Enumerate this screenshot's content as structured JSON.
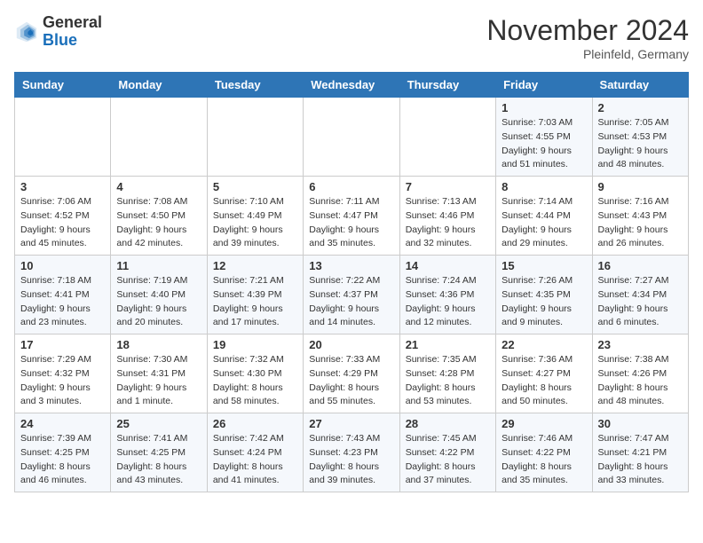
{
  "logo": {
    "general": "General",
    "blue": "Blue"
  },
  "title": "November 2024",
  "location": "Pleinfeld, Germany",
  "days_header": [
    "Sunday",
    "Monday",
    "Tuesday",
    "Wednesday",
    "Thursday",
    "Friday",
    "Saturday"
  ],
  "weeks": [
    [
      {
        "day": "",
        "info": ""
      },
      {
        "day": "",
        "info": ""
      },
      {
        "day": "",
        "info": ""
      },
      {
        "day": "",
        "info": ""
      },
      {
        "day": "",
        "info": ""
      },
      {
        "day": "1",
        "info": "Sunrise: 7:03 AM\nSunset: 4:55 PM\nDaylight: 9 hours\nand 51 minutes."
      },
      {
        "day": "2",
        "info": "Sunrise: 7:05 AM\nSunset: 4:53 PM\nDaylight: 9 hours\nand 48 minutes."
      }
    ],
    [
      {
        "day": "3",
        "info": "Sunrise: 7:06 AM\nSunset: 4:52 PM\nDaylight: 9 hours\nand 45 minutes."
      },
      {
        "day": "4",
        "info": "Sunrise: 7:08 AM\nSunset: 4:50 PM\nDaylight: 9 hours\nand 42 minutes."
      },
      {
        "day": "5",
        "info": "Sunrise: 7:10 AM\nSunset: 4:49 PM\nDaylight: 9 hours\nand 39 minutes."
      },
      {
        "day": "6",
        "info": "Sunrise: 7:11 AM\nSunset: 4:47 PM\nDaylight: 9 hours\nand 35 minutes."
      },
      {
        "day": "7",
        "info": "Sunrise: 7:13 AM\nSunset: 4:46 PM\nDaylight: 9 hours\nand 32 minutes."
      },
      {
        "day": "8",
        "info": "Sunrise: 7:14 AM\nSunset: 4:44 PM\nDaylight: 9 hours\nand 29 minutes."
      },
      {
        "day": "9",
        "info": "Sunrise: 7:16 AM\nSunset: 4:43 PM\nDaylight: 9 hours\nand 26 minutes."
      }
    ],
    [
      {
        "day": "10",
        "info": "Sunrise: 7:18 AM\nSunset: 4:41 PM\nDaylight: 9 hours\nand 23 minutes."
      },
      {
        "day": "11",
        "info": "Sunrise: 7:19 AM\nSunset: 4:40 PM\nDaylight: 9 hours\nand 20 minutes."
      },
      {
        "day": "12",
        "info": "Sunrise: 7:21 AM\nSunset: 4:39 PM\nDaylight: 9 hours\nand 17 minutes."
      },
      {
        "day": "13",
        "info": "Sunrise: 7:22 AM\nSunset: 4:37 PM\nDaylight: 9 hours\nand 14 minutes."
      },
      {
        "day": "14",
        "info": "Sunrise: 7:24 AM\nSunset: 4:36 PM\nDaylight: 9 hours\nand 12 minutes."
      },
      {
        "day": "15",
        "info": "Sunrise: 7:26 AM\nSunset: 4:35 PM\nDaylight: 9 hours\nand 9 minutes."
      },
      {
        "day": "16",
        "info": "Sunrise: 7:27 AM\nSunset: 4:34 PM\nDaylight: 9 hours\nand 6 minutes."
      }
    ],
    [
      {
        "day": "17",
        "info": "Sunrise: 7:29 AM\nSunset: 4:32 PM\nDaylight: 9 hours\nand 3 minutes."
      },
      {
        "day": "18",
        "info": "Sunrise: 7:30 AM\nSunset: 4:31 PM\nDaylight: 9 hours\nand 1 minute."
      },
      {
        "day": "19",
        "info": "Sunrise: 7:32 AM\nSunset: 4:30 PM\nDaylight: 8 hours\nand 58 minutes."
      },
      {
        "day": "20",
        "info": "Sunrise: 7:33 AM\nSunset: 4:29 PM\nDaylight: 8 hours\nand 55 minutes."
      },
      {
        "day": "21",
        "info": "Sunrise: 7:35 AM\nSunset: 4:28 PM\nDaylight: 8 hours\nand 53 minutes."
      },
      {
        "day": "22",
        "info": "Sunrise: 7:36 AM\nSunset: 4:27 PM\nDaylight: 8 hours\nand 50 minutes."
      },
      {
        "day": "23",
        "info": "Sunrise: 7:38 AM\nSunset: 4:26 PM\nDaylight: 8 hours\nand 48 minutes."
      }
    ],
    [
      {
        "day": "24",
        "info": "Sunrise: 7:39 AM\nSunset: 4:25 PM\nDaylight: 8 hours\nand 46 minutes."
      },
      {
        "day": "25",
        "info": "Sunrise: 7:41 AM\nSunset: 4:25 PM\nDaylight: 8 hours\nand 43 minutes."
      },
      {
        "day": "26",
        "info": "Sunrise: 7:42 AM\nSunset: 4:24 PM\nDaylight: 8 hours\nand 41 minutes."
      },
      {
        "day": "27",
        "info": "Sunrise: 7:43 AM\nSunset: 4:23 PM\nDaylight: 8 hours\nand 39 minutes."
      },
      {
        "day": "28",
        "info": "Sunrise: 7:45 AM\nSunset: 4:22 PM\nDaylight: 8 hours\nand 37 minutes."
      },
      {
        "day": "29",
        "info": "Sunrise: 7:46 AM\nSunset: 4:22 PM\nDaylight: 8 hours\nand 35 minutes."
      },
      {
        "day": "30",
        "info": "Sunrise: 7:47 AM\nSunset: 4:21 PM\nDaylight: 8 hours\nand 33 minutes."
      }
    ]
  ]
}
